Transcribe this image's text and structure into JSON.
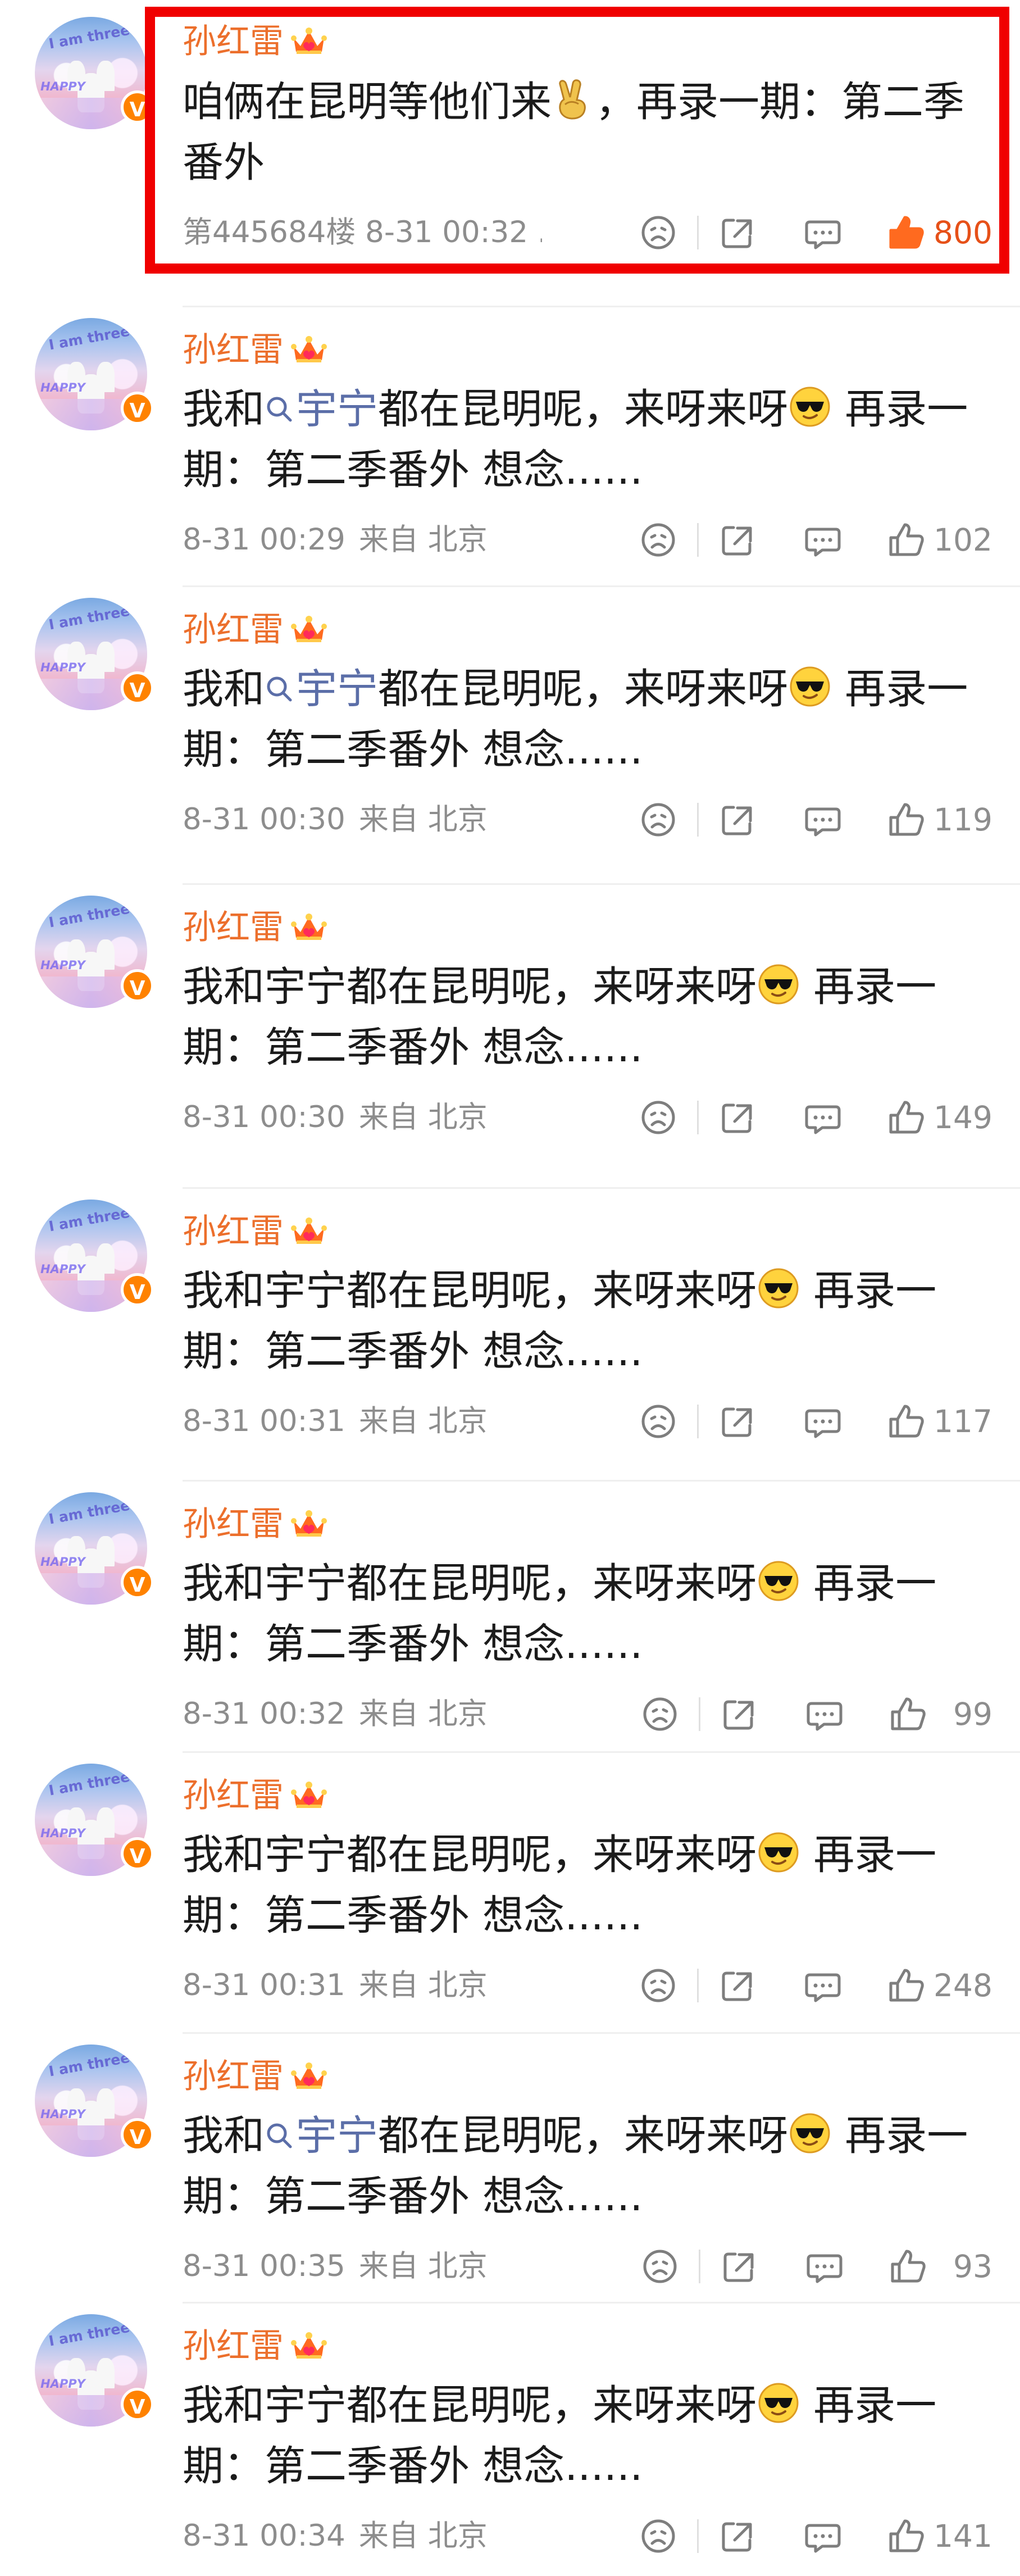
{
  "comments": [
    {
      "username": "孙红雷",
      "text_parts": [
        {
          "type": "text",
          "value": "咱俩在昆明等他们来"
        },
        {
          "type": "emoji",
          "name": "victory-hand-icon"
        },
        {
          "type": "text",
          "value": "，再录一期：第二季番外"
        }
      ],
      "meta": "第445684楼 8-31 00:32 .",
      "location": "",
      "likes": "800",
      "highlighted": true
    },
    {
      "username": "孙红雷",
      "text_parts": [
        {
          "type": "text",
          "value": "我和"
        },
        {
          "type": "topic",
          "value": "宇宁"
        },
        {
          "type": "text",
          "value": "都在昆明呢，来呀来呀"
        },
        {
          "type": "emoji",
          "name": "sunglasses-face-icon"
        },
        {
          "type": "text",
          "value": " 再录一期：第二季番外 想念......"
        }
      ],
      "meta": "8-31 00:29",
      "location": "来自 北京",
      "likes": "102",
      "highlighted": false
    },
    {
      "username": "孙红雷",
      "text_parts": [
        {
          "type": "text",
          "value": "我和"
        },
        {
          "type": "topic",
          "value": "宇宁"
        },
        {
          "type": "text",
          "value": "都在昆明呢，来呀来呀"
        },
        {
          "type": "emoji",
          "name": "sunglasses-face-icon"
        },
        {
          "type": "text",
          "value": " 再录一期：第二季番外 想念......"
        }
      ],
      "meta": "8-31 00:30",
      "location": "来自 北京",
      "likes": "119",
      "highlighted": false
    },
    {
      "username": "孙红雷",
      "text_parts": [
        {
          "type": "text",
          "value": "我和宇宁都在昆明呢，来呀来呀"
        },
        {
          "type": "emoji",
          "name": "sunglasses-face-icon"
        },
        {
          "type": "text",
          "value": " 再录一期：第二季番外 想念......"
        }
      ],
      "meta": "8-31 00:30",
      "location": "来自 北京",
      "likes": "149",
      "highlighted": false
    },
    {
      "username": "孙红雷",
      "text_parts": [
        {
          "type": "text",
          "value": "我和宇宁都在昆明呢，来呀来呀"
        },
        {
          "type": "emoji",
          "name": "sunglasses-face-icon"
        },
        {
          "type": "text",
          "value": " 再录一期：第二季番外 想念......"
        }
      ],
      "meta": "8-31 00:31",
      "location": "来自 北京",
      "likes": "117",
      "highlighted": false
    },
    {
      "username": "孙红雷",
      "text_parts": [
        {
          "type": "text",
          "value": "我和宇宁都在昆明呢，来呀来呀"
        },
        {
          "type": "emoji",
          "name": "sunglasses-face-icon"
        },
        {
          "type": "text",
          "value": " 再录一期：第二季番外 想念......"
        }
      ],
      "meta": "8-31 00:32",
      "location": "来自 北京",
      "likes": "99",
      "highlighted": false
    },
    {
      "username": "孙红雷",
      "text_parts": [
        {
          "type": "text",
          "value": "我和宇宁都在昆明呢，来呀来呀"
        },
        {
          "type": "emoji",
          "name": "sunglasses-face-icon"
        },
        {
          "type": "text",
          "value": " 再录一期：第二季番外 想念......"
        }
      ],
      "meta": "8-31 00:31",
      "location": "来自 北京",
      "likes": "248",
      "highlighted": false
    },
    {
      "username": "孙红雷",
      "text_parts": [
        {
          "type": "text",
          "value": "我和"
        },
        {
          "type": "topic",
          "value": "宇宁"
        },
        {
          "type": "text",
          "value": "都在昆明呢，来呀来呀"
        },
        {
          "type": "emoji",
          "name": "sunglasses-face-icon"
        },
        {
          "type": "text",
          "value": " 再录一期：第二季番外 想念......"
        }
      ],
      "meta": "8-31 00:35",
      "location": "来自 北京",
      "likes": "93",
      "highlighted": false
    },
    {
      "username": "孙红雷",
      "text_parts": [
        {
          "type": "text",
          "value": "我和宇宁都在昆明呢，来呀来呀"
        },
        {
          "type": "emoji",
          "name": "sunglasses-face-icon"
        },
        {
          "type": "text",
          "value": " 再录一期：第二季番外 想念......"
        }
      ],
      "meta": "8-31 00:34",
      "location": "来自 北京",
      "likes": "141",
      "highlighted": false
    }
  ],
  "avatar_text": "I am three",
  "avatar_happy_text": "HAPPY",
  "verified_badge": "V",
  "icons": [
    "crown-icon",
    "dislike-icon",
    "share-icon",
    "reply-icon",
    "like-icon",
    "search-icon"
  ],
  "colors": {
    "username": "#ec6f2c",
    "topic": "#5b6ea8",
    "meta": "#8d8d8d",
    "highlight_border": "#f00000",
    "verified": "#ff8200",
    "liked": "#e65018"
  }
}
